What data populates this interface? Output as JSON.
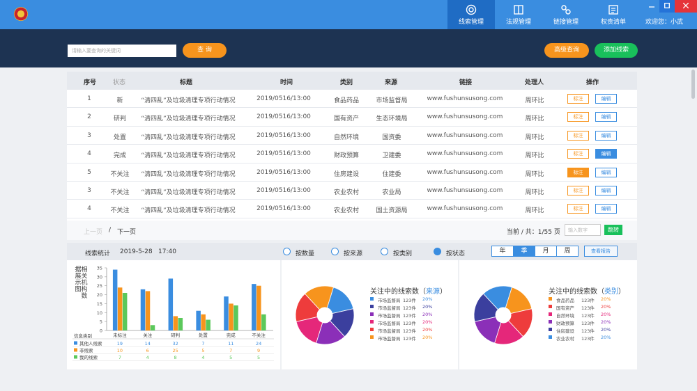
{
  "nav": {
    "tabs": [
      {
        "label": "线索管理",
        "icon": "target-icon",
        "active": true
      },
      {
        "label": "法规管理",
        "icon": "book-icon",
        "active": false
      },
      {
        "label": "链接管理",
        "icon": "link-icon",
        "active": false
      },
      {
        "label": "权责清单",
        "icon": "list-icon",
        "active": false
      }
    ],
    "welcome": "欢迎您：小武"
  },
  "search": {
    "placeholder": "请输入要查询的关键词",
    "query_label": "查 询",
    "advanced_label": "高级查询",
    "add_label": "添加线索"
  },
  "table": {
    "headers": [
      "序号",
      "状态",
      "标题",
      "时间",
      "类别",
      "来源",
      "链接",
      "处理人",
      "操作"
    ],
    "rows": [
      {
        "no": "1",
        "status": "新",
        "title": "“清四乱”及垃圾清理专项行动情况",
        "time": "2019/0516/13:00",
        "category": "食品药品",
        "source": "市场监督局",
        "link": "www.fushunsusong.com",
        "handler": "周环比",
        "mark": "标注",
        "edit": "编辑",
        "mark_solid": false,
        "edit_solid": false
      },
      {
        "no": "2",
        "status": "研判",
        "title": "“清四乱”及垃圾清理专项行动情况",
        "time": "2019/0516/13:00",
        "category": "国有资产",
        "source": "生态环境局",
        "link": "www.fushunsusong.com",
        "handler": "周环比",
        "mark": "标注",
        "edit": "编辑",
        "mark_solid": false,
        "edit_solid": false
      },
      {
        "no": "3",
        "status": "处置",
        "title": "“清四乱”及垃圾清理专项行动情况",
        "time": "2019/0516/13:00",
        "category": "自然环境",
        "source": "国资委",
        "link": "www.fushunsusong.com",
        "handler": "周环比",
        "mark": "标注",
        "edit": "编辑",
        "mark_solid": false,
        "edit_solid": false
      },
      {
        "no": "4",
        "status": "完成",
        "title": "“清四乱”及垃圾清理专项行动情况",
        "time": "2019/0516/13:00",
        "category": "财政预算",
        "source": "卫建委",
        "link": "www.fushunsusong.com",
        "handler": "周环比",
        "mark": "标注",
        "edit": "编辑",
        "mark_solid": false,
        "edit_solid": true
      },
      {
        "no": "5",
        "status": "不关注",
        "title": "“清四乱”及垃圾清理专项行动情况",
        "time": "2019/0516/13:00",
        "category": "住房建设",
        "source": "住建委",
        "link": "www.fushunsusong.com",
        "handler": "周环比",
        "mark": "标注",
        "edit": "编辑",
        "mark_solid": true,
        "edit_solid": false
      },
      {
        "no": "3",
        "status": "不关注",
        "title": "“清四乱”及垃圾清理专项行动情况",
        "time": "2019/0516/13:00",
        "category": "农业农村",
        "source": "农业局",
        "link": "www.fushunsusong.com",
        "handler": "周环比",
        "mark": "标注",
        "edit": "编辑",
        "mark_solid": false,
        "edit_solid": false
      },
      {
        "no": "4",
        "status": "不关注",
        "title": "“清四乱”及垃圾清理专项行动情况",
        "time": "2019/0516/13:00",
        "category": "农业农村",
        "source": "国土资源局",
        "link": "www.fushunsusong.com",
        "handler": "周环比",
        "mark": "标注",
        "edit": "编辑",
        "mark_solid": false,
        "edit_solid": false
      }
    ]
  },
  "pager": {
    "prev": "上一页",
    "slash": "/",
    "next": "下一页",
    "info": "当前 / 共：1/55 页",
    "input_placeholder": "输入数字",
    "go": "跳转"
  },
  "stats": {
    "title": "线索统计",
    "date": "2019-5-28",
    "time": "17:40",
    "radios": [
      {
        "label": "按数量",
        "checked": false
      },
      {
        "label": "按来源",
        "checked": false
      },
      {
        "label": "按类别",
        "checked": false
      },
      {
        "label": "按状态",
        "checked": true
      }
    ],
    "periods": [
      {
        "label": "年",
        "active": false
      },
      {
        "label": "季",
        "active": true
      },
      {
        "label": "月",
        "active": false
      },
      {
        "label": "周",
        "active": false
      }
    ],
    "report": "查看报告"
  },
  "chart_data": [
    {
      "type": "bar",
      "title": "相关机构数据展示图",
      "categories": [
        "未标注",
        "关注",
        "研判",
        "处置",
        "完成",
        "不关注"
      ],
      "ylim": [
        0,
        35
      ],
      "yticks": [
        "35",
        "30",
        "25",
        "20",
        "15",
        "10",
        "5",
        "0"
      ],
      "series": [
        {
          "name": "其他人线索",
          "color": "#3a8de0",
          "values": [
            34,
            23,
            29,
            11,
            19,
            26
          ]
        },
        {
          "name": "非线索",
          "color": "#f7941d",
          "values": [
            24,
            22,
            8,
            9,
            15,
            25
          ]
        },
        {
          "name": "我的线索",
          "color": "#5bc85b",
          "values": [
            21,
            3,
            7,
            6,
            14,
            9
          ]
        }
      ],
      "table_header": "信息类别",
      "table_values": [
        [
          "19",
          "14",
          "32",
          "7",
          "11",
          "24"
        ],
        [
          "10",
          "6",
          "25",
          "5",
          "7",
          "9"
        ],
        [
          "7",
          "4",
          "8",
          "4",
          "5",
          "5"
        ]
      ]
    },
    {
      "type": "pie",
      "title_main": "关注中的线索数（",
      "title_highlight": "来源",
      "title_end": "）",
      "slices": [
        {
          "name": "市场监督局",
          "count": "123件",
          "percent": "20%",
          "value": 20,
          "color": "#3a8de0"
        },
        {
          "name": "市场监督局",
          "count": "123件",
          "percent": "20%",
          "value": 20,
          "color": "#3b3f9e"
        },
        {
          "name": "市场监督局",
          "count": "123件",
          "percent": "20%",
          "value": 20,
          "color": "#8b2fb8"
        },
        {
          "name": "市场监督局",
          "count": "123件",
          "percent": "20%",
          "value": 20,
          "color": "#e5277a"
        },
        {
          "name": "市场监督局",
          "count": "123件",
          "percent": "20%",
          "value": 20,
          "color": "#ee3c3c"
        },
        {
          "name": "市场监督局",
          "count": "123件",
          "percent": "20%",
          "value": 20,
          "color": "#f7941d"
        }
      ]
    },
    {
      "type": "pie",
      "title_main": "关注中的线索数（",
      "title_highlight": "类别",
      "title_end": "）",
      "slices": [
        {
          "name": "食品药品",
          "count": "123件",
          "percent": "20%",
          "value": 20,
          "color": "#f7941d"
        },
        {
          "name": "国有资产",
          "count": "123件",
          "percent": "20%",
          "value": 20,
          "color": "#ee3c3c"
        },
        {
          "name": "自然环境",
          "count": "123件",
          "percent": "20%",
          "value": 20,
          "color": "#e5277a"
        },
        {
          "name": "财政预算",
          "count": "123件",
          "percent": "20%",
          "value": 20,
          "color": "#8b2fb8"
        },
        {
          "name": "住房建设",
          "count": "123件",
          "percent": "20%",
          "value": 20,
          "color": "#3b3f9e"
        },
        {
          "name": "农业农村",
          "count": "123件",
          "percent": "20%",
          "value": 20,
          "color": "#3a8de0"
        }
      ]
    }
  ]
}
